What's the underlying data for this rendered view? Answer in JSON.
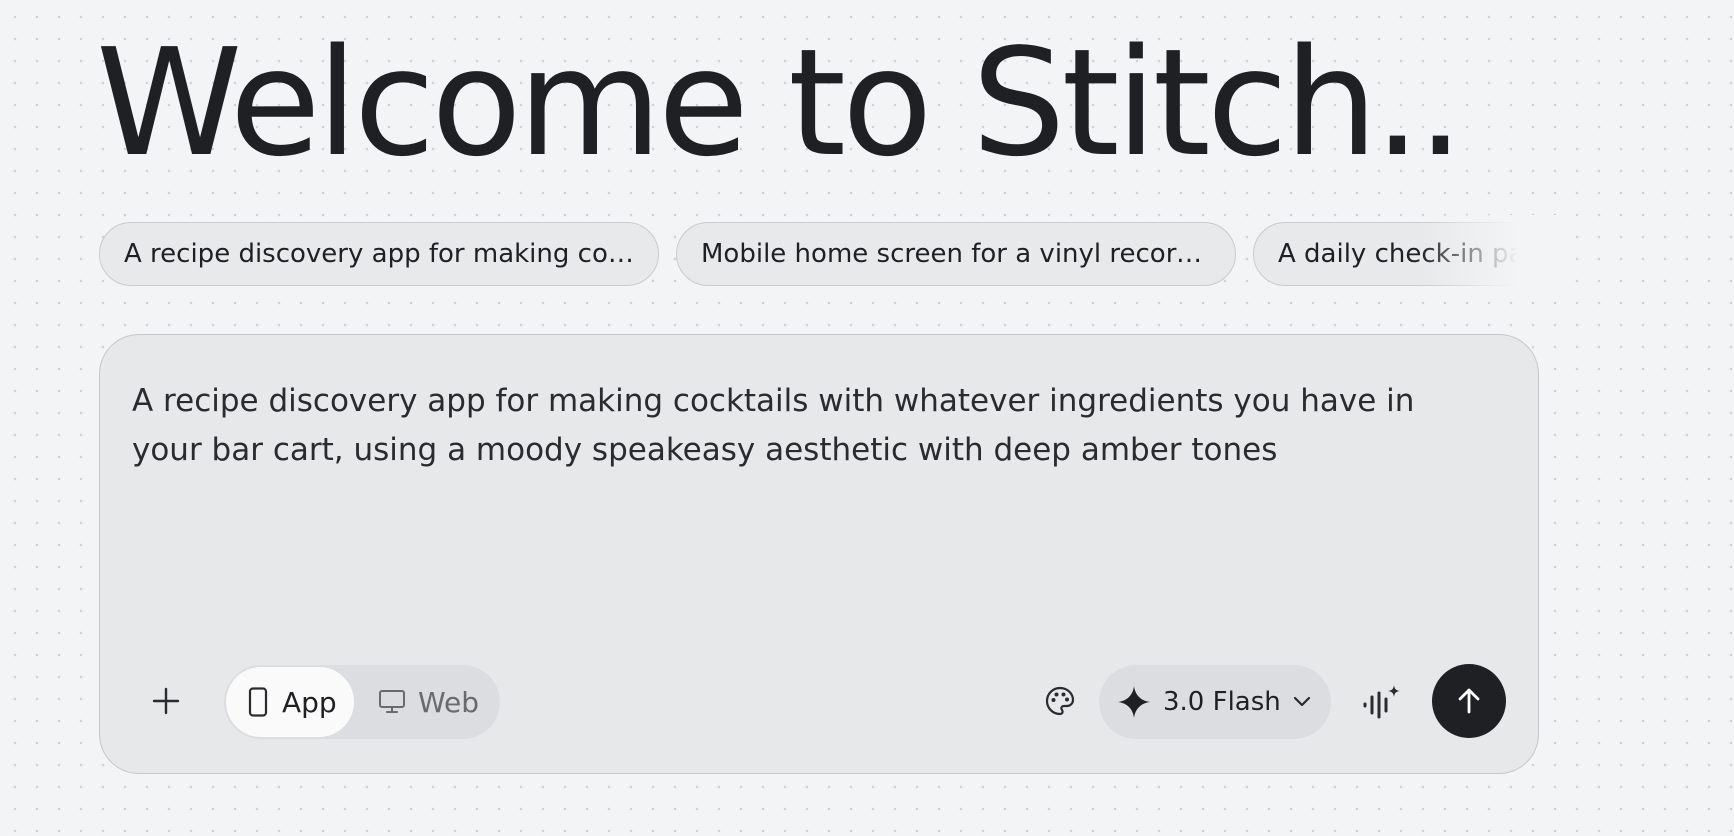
{
  "header": {
    "title": "Welcome to Stitch.."
  },
  "suggestions": [
    "A recipe discovery app for making cocktails with whatever ingredients you have in your bar cart",
    "Mobile home screen for a vinyl record store",
    "A daily check-in page"
  ],
  "composer": {
    "prompt_text": "A recipe discovery app for making cocktails with whatever ingredients you have in your bar cart, using a moody speakeasy aesthetic with deep amber tones",
    "mode_toggle": {
      "selected": "App",
      "options": [
        "App",
        "Web"
      ]
    },
    "model_selector": {
      "label": "3.0 Flash"
    }
  },
  "icons": {
    "add": "plus-icon",
    "app": "phone-icon",
    "web": "monitor-icon",
    "theme": "palette-icon",
    "model": "sparkle-icon",
    "dropdown": "chevron-down-icon",
    "voice": "voice-sparkle-icon",
    "send": "arrow-up-icon"
  },
  "colors": {
    "background": "#f3f4f5",
    "composer_bg": "#e7e8ea",
    "send_button": "#1f2023",
    "text_primary": "#1f2023",
    "text_muted": "#686a6e"
  }
}
